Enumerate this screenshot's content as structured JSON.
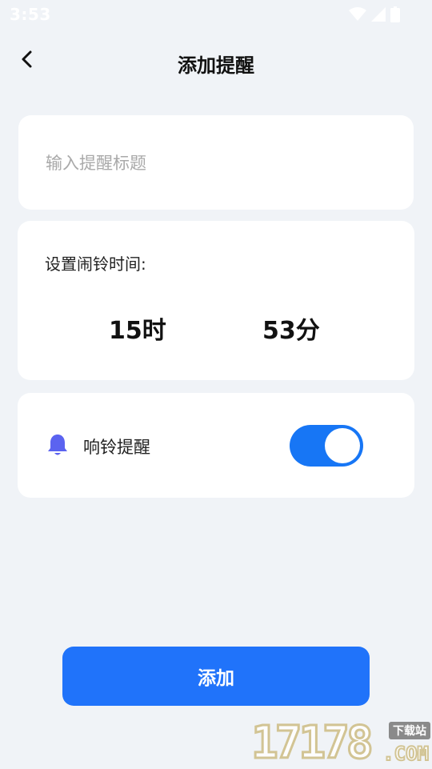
{
  "status_bar": {
    "time": "3:53",
    "icons": [
      "wifi-icon",
      "cell-signal-icon",
      "battery-icon"
    ]
  },
  "header": {
    "back_icon": "chevron-left-icon",
    "title": "添加提醒"
  },
  "title_input": {
    "placeholder": "输入提醒标题",
    "value": ""
  },
  "alarm_time": {
    "label": "设置闹铃时间:",
    "hour_value": "15",
    "hour_unit": "时",
    "minute_value": "53",
    "minute_unit": "分"
  },
  "ring_reminder": {
    "icon": "bell-icon",
    "label": "响铃提醒",
    "enabled": true
  },
  "add_button": {
    "label": "添加"
  },
  "watermark": {
    "digits": "17178",
    "badge": "下载站",
    "suffix": ".COM"
  },
  "colors": {
    "background": "#f0f3f7",
    "card": "#ffffff",
    "accent": "#2073fa",
    "toggle_on": "#1776f5",
    "bell": "#5b63f0",
    "placeholder": "#a9a9a9"
  }
}
